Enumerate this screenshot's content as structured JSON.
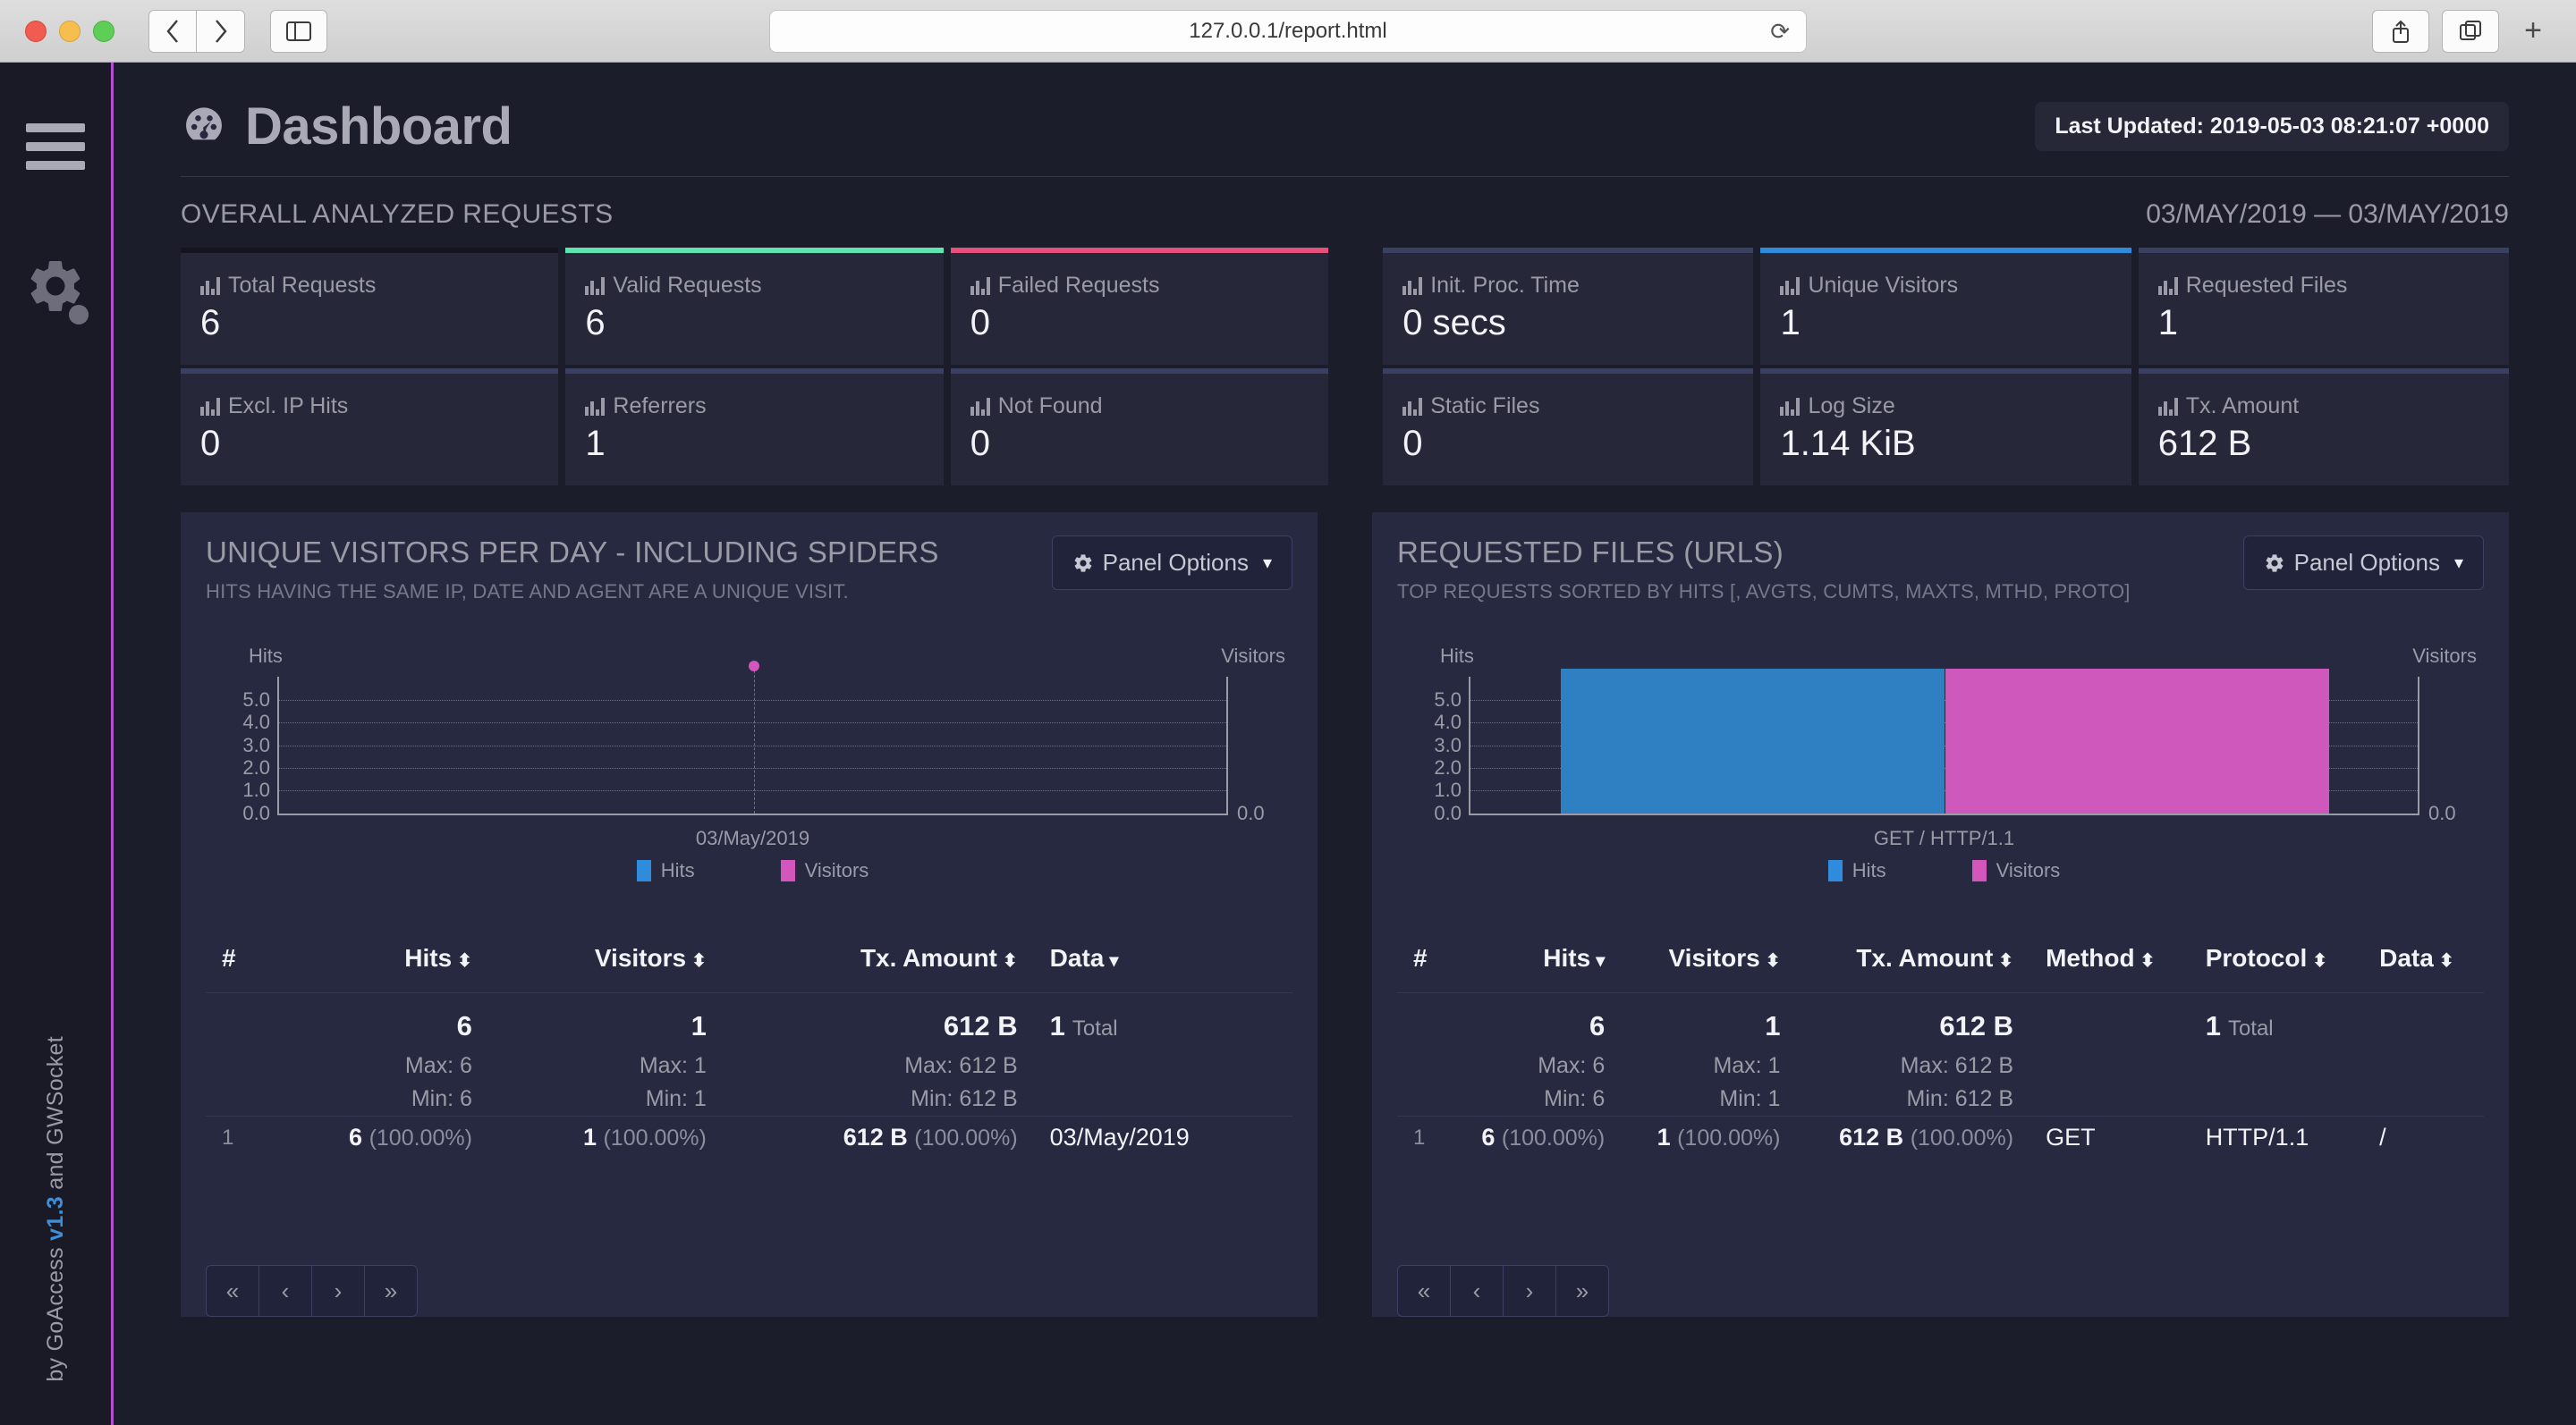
{
  "browser": {
    "url": "127.0.0.1/report.html",
    "reload_icon": "reload-icon",
    "back_icon": "chevron-left-icon",
    "forward_icon": "chevron-right-icon",
    "sidebar_icon": "sidebar-toggle-icon",
    "share_icon": "share-icon",
    "tabs_icon": "tabs-icon",
    "new_tab_icon": "plus-icon"
  },
  "sidebar": {
    "menu_icon": "hamburger-menu-icon",
    "settings_icon": "gear-icon",
    "footer_prefix": "by GoAccess ",
    "footer_version": "v1.3",
    "footer_suffix": " and GWSocket",
    "accent_color": "#b34fd0"
  },
  "header": {
    "title": "Dashboard",
    "logo_icon": "speedometer-icon",
    "last_updated": "Last Updated: 2019-05-03 08:21:07 +0000"
  },
  "overview": {
    "section_title": "OVERALL ANALYZED REQUESTS",
    "date_range": "03/MAY/2019 — 03/MAY/2019",
    "left_cards": [
      {
        "label": "Total Requests",
        "value": "6",
        "accent": "accent-dark",
        "icon": "bar-chart-icon"
      },
      {
        "label": "Valid Requests",
        "value": "6",
        "accent": "accent-green",
        "icon": "bar-chart-icon"
      },
      {
        "label": "Failed Requests",
        "value": "0",
        "accent": "accent-pink",
        "icon": "bar-chart-icon"
      },
      {
        "label": "Excl. IP Hits",
        "value": "0",
        "accent": "",
        "icon": "bar-chart-icon"
      },
      {
        "label": "Referrers",
        "value": "1",
        "accent": "",
        "icon": "bar-chart-icon"
      },
      {
        "label": "Not Found",
        "value": "0",
        "accent": "",
        "icon": "bar-chart-icon"
      }
    ],
    "right_cards": [
      {
        "label": "Init. Proc. Time",
        "value": "0 secs",
        "accent": "",
        "icon": "bar-chart-icon"
      },
      {
        "label": "Unique Visitors",
        "value": "1",
        "accent": "accent-blue",
        "icon": "bar-chart-icon"
      },
      {
        "label": "Requested Files",
        "value": "1",
        "accent": "",
        "icon": "bar-chart-icon"
      },
      {
        "label": "Static Files",
        "value": "0",
        "accent": "",
        "icon": "bar-chart-icon"
      },
      {
        "label": "Log Size",
        "value": "1.14 KiB",
        "accent": "",
        "icon": "bar-chart-icon"
      },
      {
        "label": "Tx. Amount",
        "value": "612 B",
        "accent": "",
        "icon": "bar-chart-icon"
      }
    ]
  },
  "panels": {
    "visitors": {
      "title": "UNIQUE VISITORS PER DAY - INCLUDING SPIDERS",
      "subtitle": "HITS HAVING THE SAME IP, DATE AND AGENT ARE A UNIQUE VISIT.",
      "options_label": "Panel Options",
      "options_icon": "gear-icon",
      "caret_icon": "caret-down-icon",
      "headers": [
        {
          "label": "#",
          "sort": ""
        },
        {
          "label": "Hits",
          "sort": "⬍"
        },
        {
          "label": "Visitors",
          "sort": "⬍"
        },
        {
          "label": "Tx. Amount",
          "sort": "⬍"
        },
        {
          "label": "Data",
          "sort": "▾"
        }
      ],
      "summary": {
        "hits": "6",
        "visitors": "1",
        "tx": "612 B",
        "total_count": "1",
        "total_label": "Total",
        "hits_max": "Max: 6",
        "hits_min": "Min: 6",
        "visitors_max": "Max: 1",
        "visitors_min": "Min: 1",
        "tx_max": "Max: 612 B",
        "tx_min": "Min: 612 B"
      },
      "rows": [
        {
          "idx": "1",
          "hits": "6",
          "hits_pct": "(100.00%)",
          "visitors": "1",
          "visitors_pct": "(100.00%)",
          "tx": "612 B",
          "tx_pct": "(100.00%)",
          "data": "03/May/2019"
        }
      ],
      "pager": [
        "«",
        "‹",
        "›",
        "»"
      ]
    },
    "requests": {
      "title": "REQUESTED FILES (URLS)",
      "subtitle": "TOP REQUESTS SORTED BY HITS [, AVGTS, CUMTS, MAXTS, MTHD, PROTO]",
      "options_label": "Panel Options",
      "options_icon": "gear-icon",
      "caret_icon": "caret-down-icon",
      "headers": [
        {
          "label": "#",
          "sort": ""
        },
        {
          "label": "Hits",
          "sort": "▾"
        },
        {
          "label": "Visitors",
          "sort": "⬍"
        },
        {
          "label": "Tx. Amount",
          "sort": "⬍"
        },
        {
          "label": "Method",
          "sort": "⬍"
        },
        {
          "label": "Protocol",
          "sort": "⬍"
        },
        {
          "label": "Data",
          "sort": "⬍"
        }
      ],
      "summary": {
        "hits": "6",
        "visitors": "1",
        "tx": "612 B",
        "total_count": "1",
        "total_label": "Total",
        "hits_max": "Max: 6",
        "hits_min": "Min: 6",
        "visitors_max": "Max: 1",
        "visitors_min": "Min: 1",
        "tx_max": "Max: 612 B",
        "tx_min": "Min: 612 B"
      },
      "rows": [
        {
          "idx": "1",
          "hits": "6",
          "hits_pct": "(100.00%)",
          "visitors": "1",
          "visitors_pct": "(100.00%)",
          "tx": "612 B",
          "tx_pct": "(100.00%)",
          "method": "GET",
          "protocol": "HTTP/1.1",
          "data": "/"
        }
      ],
      "pager": [
        "«",
        "‹",
        "›",
        "»"
      ]
    }
  },
  "chart_data": [
    {
      "type": "scatter",
      "title": "UNIQUE VISITORS PER DAY - INCLUDING SPIDERS",
      "x": [
        "03/May/2019"
      ],
      "series": [
        {
          "name": "Hits",
          "values": [
            6
          ],
          "color": "#2f8bdb"
        },
        {
          "name": "Visitors",
          "values": [
            1
          ],
          "color": "#d456bd"
        }
      ],
      "ylabel": "Hits",
      "y2label": "Visitors",
      "yticks": [
        "5.0",
        "4.0",
        "3.0",
        "2.0",
        "1.0",
        "0.0"
      ],
      "y2ticks": [
        "0.0"
      ],
      "ylim": [
        0,
        6
      ],
      "grid": true,
      "legend": [
        "Hits",
        "Visitors"
      ],
      "legend_position": "bottom",
      "xlabel": "03/May/2019"
    },
    {
      "type": "bar",
      "title": "REQUESTED FILES (URLS)",
      "categories": [
        "GET / HTTP/1.1"
      ],
      "series": [
        {
          "name": "Hits",
          "values": [
            6
          ],
          "color": "#2f80c2"
        },
        {
          "name": "Visitors",
          "values": [
            1
          ],
          "color": "#cf58bd"
        }
      ],
      "ylabel": "Hits",
      "y2label": "Visitors",
      "yticks": [
        "5.0",
        "4.0",
        "3.0",
        "2.0",
        "1.0",
        "0.0"
      ],
      "y2ticks": [
        "0.0"
      ],
      "ylim": [
        0,
        6
      ],
      "grid": true,
      "legend": [
        "Hits",
        "Visitors"
      ],
      "legend_position": "bottom",
      "xlabel": "GET / HTTP/1.1"
    }
  ]
}
